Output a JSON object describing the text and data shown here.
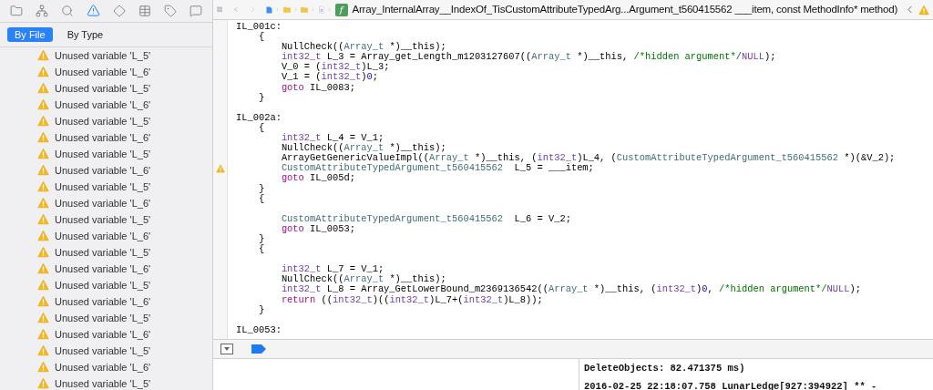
{
  "navigator": {
    "tabs": [
      {
        "label": "By File",
        "selected": true
      },
      {
        "label": "By Type",
        "selected": false
      }
    ],
    "issues": [
      {
        "text": "Unused variable 'L_5'"
      },
      {
        "text": "Unused variable 'L_6'"
      },
      {
        "text": "Unused variable 'L_5'"
      },
      {
        "text": "Unused variable 'L_6'"
      },
      {
        "text": "Unused variable 'L_5'"
      },
      {
        "text": "Unused variable 'L_6'"
      },
      {
        "text": "Unused variable 'L_5'"
      },
      {
        "text": "Unused variable 'L_6'"
      },
      {
        "text": "Unused variable 'L_5'"
      },
      {
        "text": "Unused variable 'L_6'"
      },
      {
        "text": "Unused variable 'L_5'"
      },
      {
        "text": "Unused variable 'L_6'"
      },
      {
        "text": "Unused variable 'L_5'"
      },
      {
        "text": "Unused variable 'L_6'"
      },
      {
        "text": "Unused variable 'L_5'"
      },
      {
        "text": "Unused variable 'L_6'"
      },
      {
        "text": "Unused variable 'L_5'"
      },
      {
        "text": "Unused variable 'L_6'"
      },
      {
        "text": "Unused variable 'L_5'"
      },
      {
        "text": "Unused variable 'L_6'"
      },
      {
        "text": "Unused variable 'L_5'"
      }
    ]
  },
  "jump_bar": {
    "function_badge": "f",
    "title": "Array_InternalArray__IndexOf_TisCustomAttributeTypedArg...Argument_t560415562 ___item, const MethodInfo* method)"
  },
  "code_lines": [
    {
      "kind": "code",
      "segments": [
        {
          "kind": "plain",
          "text": "IL_001c:"
        }
      ]
    },
    {
      "kind": "code",
      "segments": [
        {
          "kind": "plain",
          "text": "    {"
        }
      ]
    },
    {
      "kind": "code",
      "segments": [
        {
          "kind": "plain",
          "text": "        NullCheck(("
        },
        {
          "kind": "type",
          "text": "Array_t"
        },
        {
          "kind": "plain",
          "text": " *)__this);"
        }
      ]
    },
    {
      "kind": "code",
      "segments": [
        {
          "kind": "builtin",
          "text": "        int32_t"
        },
        {
          "kind": "plain",
          "text": " L_3 = Array_get_Length_m1203127607(("
        },
        {
          "kind": "type",
          "text": "Array_t"
        },
        {
          "kind": "plain",
          "text": " *)__this, "
        },
        {
          "kind": "comment",
          "text": "/*hidden argument*/"
        },
        {
          "kind": "builtin",
          "text": "NULL"
        },
        {
          "kind": "plain",
          "text": ");"
        }
      ]
    },
    {
      "kind": "code",
      "segments": [
        {
          "kind": "plain",
          "text": "        V_0 = ("
        },
        {
          "kind": "builtin",
          "text": "int32_t"
        },
        {
          "kind": "plain",
          "text": ")L_3;"
        }
      ]
    },
    {
      "kind": "code",
      "segments": [
        {
          "kind": "plain",
          "text": "        V_1 = ("
        },
        {
          "kind": "builtin",
          "text": "int32_t"
        },
        {
          "kind": "plain",
          "text": ")"
        },
        {
          "kind": "number",
          "text": "0"
        },
        {
          "kind": "plain",
          "text": ";"
        }
      ]
    },
    {
      "kind": "code",
      "segments": [
        {
          "kind": "keyword",
          "text": "        goto"
        },
        {
          "kind": "plain",
          "text": " IL_0083;"
        }
      ]
    },
    {
      "kind": "code",
      "segments": [
        {
          "kind": "plain",
          "text": "    }"
        }
      ]
    },
    {
      "kind": "blank"
    },
    {
      "kind": "code",
      "segments": [
        {
          "kind": "plain",
          "text": "IL_002a:"
        }
      ]
    },
    {
      "kind": "code",
      "segments": [
        {
          "kind": "plain",
          "text": "    {"
        }
      ]
    },
    {
      "kind": "code",
      "segments": [
        {
          "kind": "builtin",
          "text": "        int32_t"
        },
        {
          "kind": "plain",
          "text": " L_4 = V_1;"
        }
      ]
    },
    {
      "kind": "code",
      "segments": [
        {
          "kind": "plain",
          "text": "        NullCheck(("
        },
        {
          "kind": "type",
          "text": "Array_t"
        },
        {
          "kind": "plain",
          "text": " *)__this);"
        }
      ]
    },
    {
      "kind": "code",
      "segments": [
        {
          "kind": "plain",
          "text": "        ArrayGetGenericValueImpl(("
        },
        {
          "kind": "type",
          "text": "Array_t"
        },
        {
          "kind": "plain",
          "text": " *)__this, ("
        },
        {
          "kind": "builtin",
          "text": "int32_t"
        },
        {
          "kind": "plain",
          "text": ")L_4, ("
        },
        {
          "kind": "type",
          "text": "CustomAttributeTypedArgument_t560415562"
        },
        {
          "kind": "plain",
          "text": " *)(&V_2);"
        }
      ]
    },
    {
      "kind": "code",
      "warning": true,
      "segments": [
        {
          "kind": "type",
          "text": "        CustomAttributeTypedArgument_t560415562"
        },
        {
          "kind": "plain",
          "text": "  L_5 = ___item;"
        }
      ]
    },
    {
      "kind": "code",
      "segments": [
        {
          "kind": "keyword",
          "text": "        goto"
        },
        {
          "kind": "plain",
          "text": " IL_005d;"
        }
      ]
    },
    {
      "kind": "code",
      "segments": [
        {
          "kind": "plain",
          "text": "    }"
        }
      ]
    },
    {
      "kind": "code",
      "segments": [
        {
          "kind": "plain",
          "text": "    {"
        }
      ]
    },
    {
      "kind": "blank"
    },
    {
      "kind": "code",
      "segments": [
        {
          "kind": "type",
          "text": "        CustomAttributeTypedArgument_t560415562"
        },
        {
          "kind": "plain",
          "text": "  L_6 = V_2;"
        }
      ]
    },
    {
      "kind": "code",
      "segments": [
        {
          "kind": "keyword",
          "text": "        goto"
        },
        {
          "kind": "plain",
          "text": " IL_0053;"
        }
      ]
    },
    {
      "kind": "code",
      "segments": [
        {
          "kind": "plain",
          "text": "    }"
        }
      ]
    },
    {
      "kind": "code",
      "segments": [
        {
          "kind": "plain",
          "text": "    {"
        }
      ]
    },
    {
      "kind": "blank"
    },
    {
      "kind": "code",
      "segments": [
        {
          "kind": "builtin",
          "text": "        int32_t"
        },
        {
          "kind": "plain",
          "text": " L_7 = V_1;"
        }
      ]
    },
    {
      "kind": "code",
      "segments": [
        {
          "kind": "plain",
          "text": "        NullCheck(("
        },
        {
          "kind": "type",
          "text": "Array_t"
        },
        {
          "kind": "plain",
          "text": " *)__this);"
        }
      ]
    },
    {
      "kind": "code",
      "segments": [
        {
          "kind": "builtin",
          "text": "        int32_t"
        },
        {
          "kind": "plain",
          "text": " L_8 = Array_GetLowerBound_m2369136542(("
        },
        {
          "kind": "type",
          "text": "Array_t"
        },
        {
          "kind": "plain",
          "text": " *)__this, ("
        },
        {
          "kind": "builtin",
          "text": "int32_t"
        },
        {
          "kind": "plain",
          "text": ")"
        },
        {
          "kind": "number",
          "text": "0"
        },
        {
          "kind": "plain",
          "text": ", "
        },
        {
          "kind": "comment",
          "text": "/*hidden argument*/"
        },
        {
          "kind": "builtin",
          "text": "NULL"
        },
        {
          "kind": "plain",
          "text": ");"
        }
      ]
    },
    {
      "kind": "code",
      "segments": [
        {
          "kind": "keyword",
          "text": "        return"
        },
        {
          "kind": "plain",
          "text": " (("
        },
        {
          "kind": "builtin",
          "text": "int32_t"
        },
        {
          "kind": "plain",
          "text": ")(("
        },
        {
          "kind": "builtin",
          "text": "int32_t"
        },
        {
          "kind": "plain",
          "text": ")L_7+("
        },
        {
          "kind": "builtin",
          "text": "int32_t"
        },
        {
          "kind": "plain",
          "text": ")L_8));"
        }
      ]
    },
    {
      "kind": "code",
      "segments": [
        {
          "kind": "plain",
          "text": "    }"
        }
      ]
    },
    {
      "kind": "blank"
    },
    {
      "kind": "code",
      "segments": [
        {
          "kind": "plain",
          "text": "IL_0053:"
        }
      ]
    }
  ],
  "console": {
    "lines": [
      "DeleteObjects: 82.471375 ms)",
      "2016-02-25 22:18:07.758 LunarLedge[927:394922] ** -"
    ]
  }
}
